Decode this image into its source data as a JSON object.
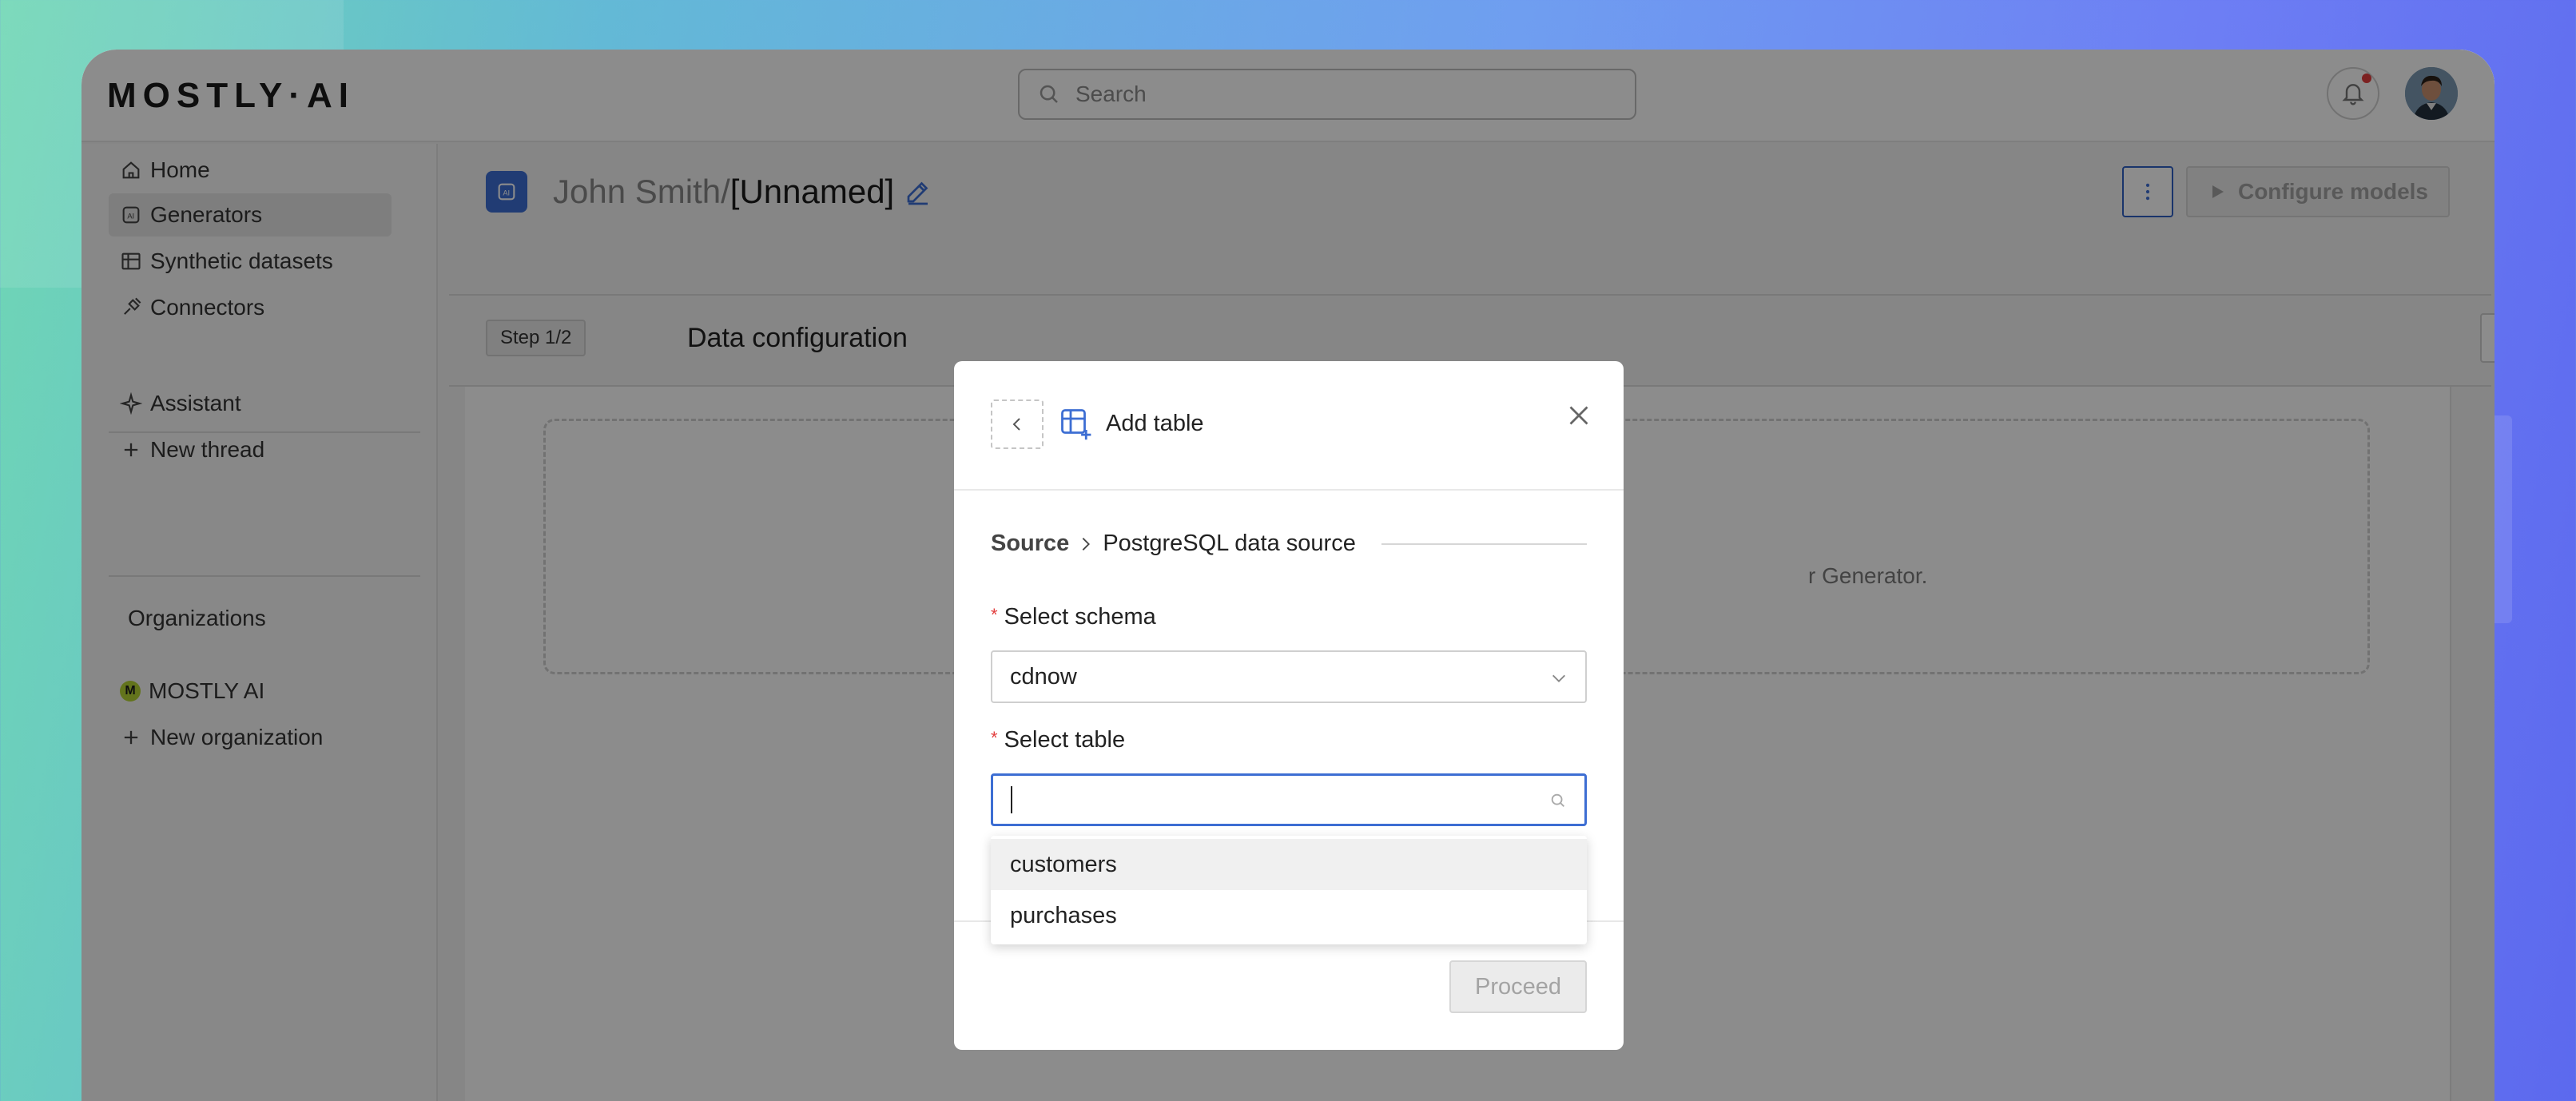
{
  "header": {
    "logo_text": "MOSTLY·AI",
    "search_placeholder": "Search"
  },
  "sidebar": {
    "items": [
      {
        "label": "Home",
        "icon": "home-icon"
      },
      {
        "label": "Generators",
        "icon": "generator-icon",
        "active": true
      },
      {
        "label": "Synthetic datasets",
        "icon": "table-icon"
      },
      {
        "label": "Connectors",
        "icon": "plug-icon"
      }
    ],
    "assistant": {
      "label": "Assistant",
      "icon": "sparkle-icon"
    },
    "new_thread": {
      "label": "New thread",
      "icon": "plus-icon"
    },
    "organizations_title": "Organizations",
    "org": {
      "label": "MOSTLY AI",
      "badge": "M"
    },
    "new_org": {
      "label": "New organization",
      "icon": "plus-icon"
    }
  },
  "main": {
    "owner": "John Smith/",
    "generator_name": "[Unnamed]",
    "configure_label": "Configure models",
    "step_badge": "Step 1/2",
    "step_title": "Data configuration",
    "dropzone_text": "r Generator."
  },
  "modal": {
    "title": "Add table",
    "breadcrumb": {
      "source": "Source",
      "current": "PostgreSQL data source"
    },
    "schema": {
      "label": "Select schema",
      "value": "cdnow"
    },
    "table": {
      "label": "Select table",
      "value": ""
    },
    "options": [
      "customers",
      "purchases"
    ],
    "proceed_label": "Proceed"
  },
  "colors": {
    "accent": "#3d6ed3",
    "required": "#e23d3d",
    "notification": "#e23d3d"
  }
}
